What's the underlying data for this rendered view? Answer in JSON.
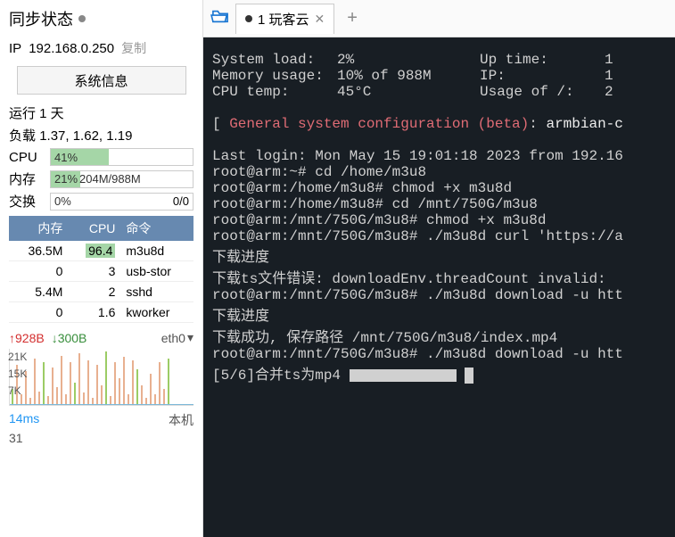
{
  "sidebar": {
    "title": "同步状态",
    "ip_label": "IP",
    "ip": "192.168.0.250",
    "copy_label": "复制",
    "sysinfo_btn": "系统信息",
    "uptime": "运行 1 天",
    "load_label": "负载",
    "load": "1.37, 1.62, 1.19",
    "cpu_label": "CPU",
    "cpu_pct": "41%",
    "mem_label": "内存",
    "mem_pct": "21%",
    "mem_text": "204M/988M",
    "swap_label": "交换",
    "swap_pct": "0%",
    "swap_text": "0/0",
    "proc_headers": [
      "内存",
      "CPU",
      "命令"
    ],
    "procs": [
      {
        "mem": "36.5M",
        "cpu": "96.4",
        "cmd": "m3u8d",
        "hot": true
      },
      {
        "mem": "0",
        "cpu": "3",
        "cmd": "usb-stor"
      },
      {
        "mem": "5.4M",
        "cpu": "2",
        "cmd": "sshd"
      },
      {
        "mem": "0",
        "cpu": "1.6",
        "cmd": "kworker"
      }
    ],
    "net_up": "↑928B",
    "net_down": "↓300B",
    "net_iface": "eth0",
    "spark_y": [
      "21K",
      "15K",
      "7K"
    ],
    "latency": "14ms",
    "latency2": "31",
    "host_label": "本机"
  },
  "tabs": {
    "active": "1 玩客云"
  },
  "term": {
    "sys_rows": [
      {
        "label": "System load:",
        "val": "2%",
        "lab2": "Up time:",
        "val2": "1"
      },
      {
        "label": "Memory usage:",
        "val": "10% of 988M",
        "lab2": "IP:",
        "val2": "1"
      },
      {
        "label": "CPU temp:",
        "val": "45°C",
        "lab2": "Usage of /:",
        "val2": "2"
      }
    ],
    "config_prefix": "[ ",
    "config_red": "General system configuration (beta)",
    "config_suffix": ": ",
    "config_cmd": "armbian-c",
    "last_login": "Last login: Mon May 15 19:01:18 2023 from 192.16",
    "lines": [
      "root@arm:~# cd /home/m3u8",
      "root@arm:/home/m3u8# chmod +x m3u8d",
      "root@arm:/home/m3u8# cd /mnt/750G/m3u8",
      "root@arm:/mnt/750G/m3u8# chmod +x m3u8d",
      "root@arm:/mnt/750G/m3u8# ./m3u8d curl 'https://a",
      "下载进度",
      "下载ts文件错误: downloadEnv.threadCount invalid:",
      "root@arm:/mnt/750G/m3u8# ./m3u8d download -u htt",
      "下载进度",
      "下载成功, 保存路径 /mnt/750G/m3u8/index.mp4",
      "root@arm:/mnt/750G/m3u8# ./m3u8d download -u htt"
    ],
    "progress": "[5/6]合并ts为mp4 "
  }
}
